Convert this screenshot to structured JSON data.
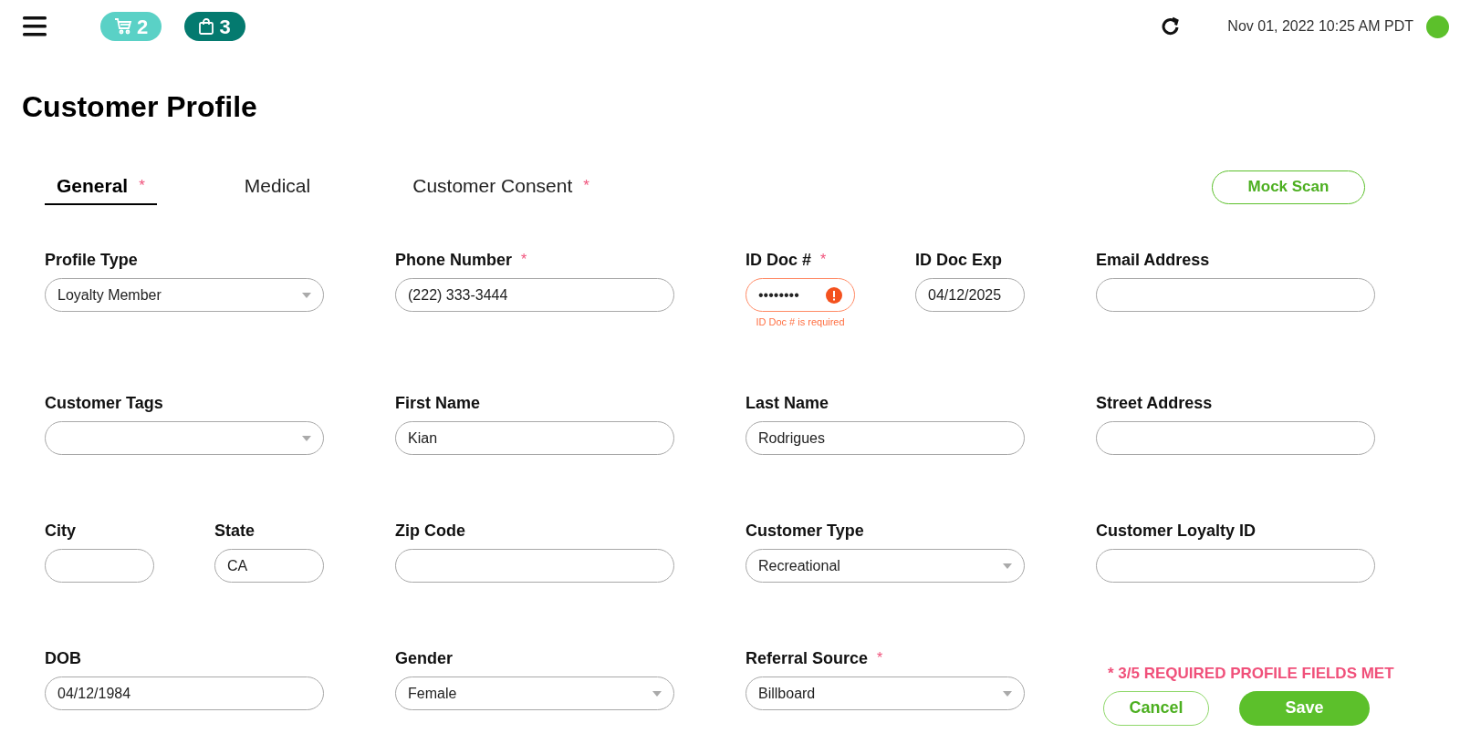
{
  "header": {
    "cart_count": "2",
    "bag_count": "3",
    "datetime": "Nov 01, 2022 10:25 AM PDT",
    "online": true
  },
  "title": "Customer Profile",
  "tabs": [
    {
      "label": "General",
      "required_mark": "*",
      "selected": true
    },
    {
      "label": "Medical",
      "selected": false
    },
    {
      "label": "Customer Consent",
      "required_mark": "*",
      "selected": false
    }
  ],
  "mock_scan_button": "Mock Scan",
  "rows": [
    [
      [
        {
          "label": "Profile Type",
          "kind": "select",
          "value": "Loyalty Member"
        }
      ],
      [
        {
          "label": "Phone Number",
          "required_mark": "*",
          "kind": "text",
          "value": "(222) 333-3444"
        }
      ],
      [
        {
          "label": "ID Doc #",
          "required_mark": "*",
          "kind": "text",
          "value": "••••••••",
          "error": "ID Doc # is required"
        },
        {
          "label": "ID Doc Exp",
          "kind": "text",
          "value": "04/12/2025"
        }
      ],
      [
        {
          "label": "Email Address",
          "kind": "text"
        }
      ]
    ],
    [
      [
        {
          "label": "Customer Tags",
          "kind": "select"
        }
      ],
      [
        {
          "label": "First Name",
          "kind": "text",
          "value": "Kian"
        }
      ],
      [
        {
          "label": "Last Name",
          "kind": "text",
          "value": "Rodrigues"
        }
      ],
      [
        {
          "label": "Street Address",
          "kind": "text"
        }
      ]
    ],
    [
      [
        {
          "label": "City",
          "kind": "text"
        },
        {
          "label": "State",
          "kind": "text",
          "value": "CA"
        }
      ],
      [
        {
          "label": "Zip Code",
          "kind": "text"
        }
      ],
      [
        {
          "label": "Customer Type",
          "kind": "select",
          "value": "Recreational"
        }
      ],
      [
        {
          "label": "Customer Loyalty ID",
          "kind": "text"
        }
      ]
    ],
    [
      [
        {
          "label": "DOB",
          "kind": "text",
          "value": "04/12/1984"
        }
      ],
      [
        {
          "label": "Gender",
          "kind": "select",
          "value": "Female"
        }
      ],
      [
        {
          "label": "Referral Source",
          "required_mark": "*",
          "kind": "select",
          "value": "Billboard"
        }
      ]
    ]
  ],
  "footer": {
    "status": "* 3/5 REQUIRED PROFILE FIELDS MET",
    "cancel_button": "Cancel",
    "save_button": "Save"
  }
}
